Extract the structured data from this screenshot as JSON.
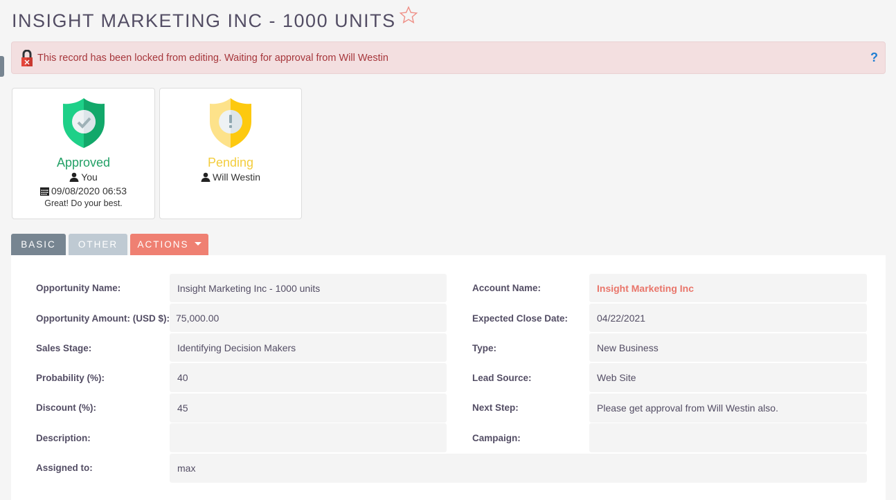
{
  "header": {
    "title": "INSIGHT MARKETING INC - 1000 UNITS",
    "favorite_icon": "star-outline-icon"
  },
  "alert": {
    "icon": "lock-icon",
    "message": "This record has been locked from editing. Waiting for approval from Will Westin",
    "help_icon": "?"
  },
  "approvals": [
    {
      "status": "Approved",
      "icon": "shield-check-icon",
      "user": "You",
      "datetime": "09/08/2020 06:53",
      "comment": "Great! Do your best.",
      "color": "#23a066"
    },
    {
      "status": "Pending",
      "icon": "shield-exclamation-icon",
      "user": "Will Westin",
      "color": "#f3cd3e"
    }
  ],
  "tabs": {
    "basic": "BASIC",
    "other": "OTHER",
    "actions": "ACTIONS"
  },
  "fields": {
    "left": [
      {
        "label": "Opportunity Name:",
        "value": "Insight Marketing Inc - 1000 units"
      },
      {
        "label": "Opportunity Amount: (USD $):",
        "value": "75,000.00"
      },
      {
        "label": "Sales Stage:",
        "value": "Identifying Decision Makers"
      },
      {
        "label": "Probability (%):",
        "value": "40"
      },
      {
        "label": "Discount (%):",
        "value": "45"
      },
      {
        "label": "Description:",
        "value": ""
      }
    ],
    "right": [
      {
        "label": "Account Name:",
        "value": "Insight Marketing Inc"
      },
      {
        "label": "Expected Close Date:",
        "value": "04/22/2021"
      },
      {
        "label": "Type:",
        "value": "New Business"
      },
      {
        "label": "Lead Source:",
        "value": "Web Site"
      },
      {
        "label": "Next Step:",
        "value": "Please get approval from Will Westin also."
      },
      {
        "label": "Campaign:",
        "value": ""
      }
    ],
    "assigned": {
      "label": "Assigned to:",
      "value": "max"
    }
  },
  "colors": {
    "accent": "#ef8072",
    "alert_bg": "#f3dfe0",
    "alert_text": "#a6363b",
    "tab_active": "#778591",
    "tab_inactive": "#bfcad3"
  }
}
